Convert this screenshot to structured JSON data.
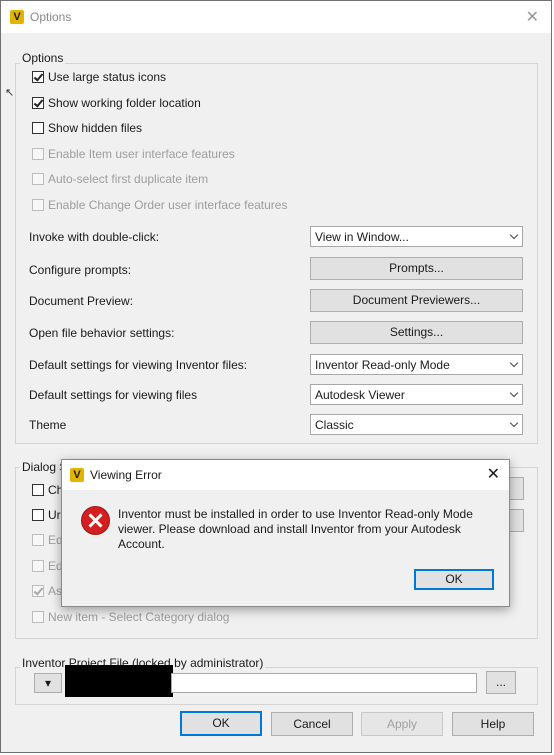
{
  "window": {
    "title": "Options",
    "close_symbol": "✕"
  },
  "options": {
    "group_label": "Options",
    "checkboxes": [
      {
        "label": "Use large status icons",
        "checked": true,
        "enabled": true
      },
      {
        "label": "Show working folder location",
        "checked": true,
        "enabled": true
      },
      {
        "label": "Show hidden files",
        "checked": false,
        "enabled": true
      },
      {
        "label": "Enable Item user interface features",
        "checked": false,
        "enabled": false
      },
      {
        "label": "Auto-select first duplicate item",
        "checked": false,
        "enabled": false
      },
      {
        "label": "Enable Change Order user interface features",
        "checked": false,
        "enabled": false
      }
    ],
    "settings": {
      "invoke_label": "Invoke with double-click:",
      "invoke_value": "View in Window...",
      "prompts_label": "Configure prompts:",
      "prompts_button": "Prompts...",
      "preview_label": "Document Preview:",
      "preview_button": "Document Previewers...",
      "open_label": "Open file behavior settings:",
      "open_button": "Settings...",
      "inventor_label": "Default settings for viewing Inventor files:",
      "inventor_value": "Inventor Read-only Mode",
      "files_label": "Default settings for viewing files",
      "files_value": "Autodesk Viewer",
      "theme_label": "Theme",
      "theme_value": "Classic"
    }
  },
  "dialog_suppression": {
    "group_label": "Dialog S",
    "items": [
      {
        "label": "Ch",
        "checked": false,
        "enabled": true
      },
      {
        "label": "Ur",
        "checked": false,
        "enabled": true
      },
      {
        "label": "Ed",
        "checked": false,
        "enabled": false
      },
      {
        "label": "Ed",
        "checked": false,
        "enabled": false
      },
      {
        "label": "As",
        "checked": true,
        "enabled": false
      },
      {
        "label": "New item - Select Category dialog",
        "checked": false,
        "enabled": false
      }
    ]
  },
  "project_file": {
    "group_label": "Inventor Project File (locked by administrator)",
    "dropdown_symbol": "▾",
    "browse_label": "..."
  },
  "footer": {
    "ok": "OK",
    "cancel": "Cancel",
    "apply": "Apply",
    "help": "Help"
  },
  "error_dialog": {
    "title": "Viewing Error",
    "close_symbol": "✕",
    "message": "Inventor must be installed in order to use Inventor Read-only Mode viewer. Please download and install Inventor from your Autodesk Account.",
    "ok": "OK"
  },
  "icons": {
    "app_icon": "autodesk-vault-icon",
    "error": "error-icon"
  },
  "colors": {
    "focus_blue": "#0078d7",
    "error_red": "#d21f1f",
    "app_icon_gold": "#e2b400"
  }
}
